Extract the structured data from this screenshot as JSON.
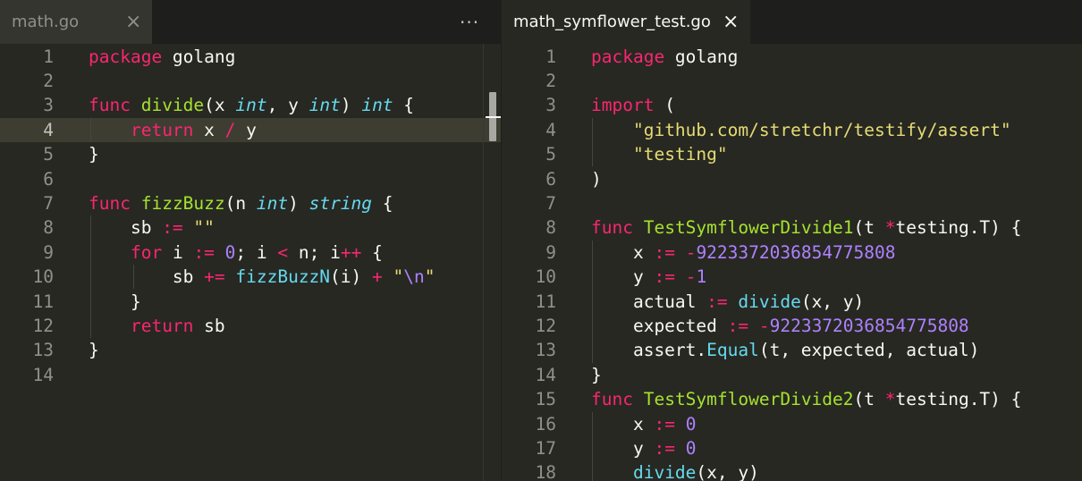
{
  "left_pane": {
    "tab": {
      "title": "math.go",
      "close_glyph": "×"
    },
    "more_glyph": "···",
    "current_line": 4,
    "lines": [
      {
        "n": "1",
        "t": [
          [
            "kw",
            "package"
          ],
          [
            "pl",
            " golang"
          ]
        ]
      },
      {
        "n": "2",
        "t": []
      },
      {
        "n": "3",
        "t": [
          [
            "kw",
            "func"
          ],
          [
            "pl",
            " "
          ],
          [
            "fn",
            "divide"
          ],
          [
            "pl",
            "(x "
          ],
          [
            "ty",
            "int"
          ],
          [
            "pl",
            ", y "
          ],
          [
            "ty",
            "int"
          ],
          [
            "pl",
            ") "
          ],
          [
            "ty",
            "int"
          ],
          [
            "pl",
            " {"
          ]
        ]
      },
      {
        "n": "4",
        "t": [
          [
            "pl",
            "    "
          ],
          [
            "kw",
            "return"
          ],
          [
            "pl",
            " x "
          ],
          [
            "op",
            "/"
          ],
          [
            "pl",
            " y"
          ]
        ]
      },
      {
        "n": "5",
        "t": [
          [
            "pl",
            "}"
          ]
        ]
      },
      {
        "n": "6",
        "t": []
      },
      {
        "n": "7",
        "t": [
          [
            "kw",
            "func"
          ],
          [
            "pl",
            " "
          ],
          [
            "fn",
            "fizzBuzz"
          ],
          [
            "pl",
            "(n "
          ],
          [
            "ty",
            "int"
          ],
          [
            "pl",
            ") "
          ],
          [
            "ty",
            "string"
          ],
          [
            "pl",
            " {"
          ]
        ]
      },
      {
        "n": "8",
        "t": [
          [
            "pl",
            "    sb "
          ],
          [
            "op",
            ":="
          ],
          [
            "pl",
            " "
          ],
          [
            "str",
            "\"\""
          ]
        ]
      },
      {
        "n": "9",
        "t": [
          [
            "pl",
            "    "
          ],
          [
            "kw",
            "for"
          ],
          [
            "pl",
            " i "
          ],
          [
            "op",
            ":="
          ],
          [
            "pl",
            " "
          ],
          [
            "num",
            "0"
          ],
          [
            "pl",
            "; i "
          ],
          [
            "op",
            "<"
          ],
          [
            "pl",
            " n; i"
          ],
          [
            "op",
            "++"
          ],
          [
            "pl",
            " {"
          ]
        ]
      },
      {
        "n": "10",
        "t": [
          [
            "pl",
            "        sb "
          ],
          [
            "op",
            "+="
          ],
          [
            "pl",
            " "
          ],
          [
            "call",
            "fizzBuzzN"
          ],
          [
            "pl",
            "(i) "
          ],
          [
            "op",
            "+"
          ],
          [
            "pl",
            " "
          ],
          [
            "str",
            "\""
          ],
          [
            "num",
            "\\n"
          ],
          [
            "str",
            "\""
          ]
        ]
      },
      {
        "n": "11",
        "t": [
          [
            "pl",
            "    }"
          ]
        ]
      },
      {
        "n": "12",
        "t": [
          [
            "pl",
            "    "
          ],
          [
            "kw",
            "return"
          ],
          [
            "pl",
            " sb"
          ]
        ]
      },
      {
        "n": "13",
        "t": [
          [
            "pl",
            "}"
          ]
        ]
      },
      {
        "n": "14",
        "t": []
      }
    ]
  },
  "right_pane": {
    "tab": {
      "title": "math_symflower_test.go",
      "close_glyph": "×"
    },
    "lines": [
      {
        "n": "1",
        "t": [
          [
            "kw",
            "package"
          ],
          [
            "pl",
            " golang"
          ]
        ]
      },
      {
        "n": "2",
        "t": []
      },
      {
        "n": "3",
        "t": [
          [
            "kw",
            "import"
          ],
          [
            "pl",
            " ("
          ]
        ]
      },
      {
        "n": "4",
        "t": [
          [
            "pl",
            "    "
          ],
          [
            "str",
            "\"github.com/stretchr/testify/assert\""
          ]
        ]
      },
      {
        "n": "5",
        "t": [
          [
            "pl",
            "    "
          ],
          [
            "str",
            "\"testing\""
          ]
        ]
      },
      {
        "n": "6",
        "t": [
          [
            "pl",
            ")"
          ]
        ]
      },
      {
        "n": "7",
        "t": []
      },
      {
        "n": "8",
        "t": [
          [
            "kw",
            "func"
          ],
          [
            "pl",
            " "
          ],
          [
            "fn",
            "TestSymflowerDivide1"
          ],
          [
            "pl",
            "(t "
          ],
          [
            "op",
            "*"
          ],
          [
            "pl",
            "testing.T) {"
          ]
        ]
      },
      {
        "n": "9",
        "t": [
          [
            "pl",
            "    x "
          ],
          [
            "op",
            ":="
          ],
          [
            "pl",
            " "
          ],
          [
            "op",
            "-"
          ],
          [
            "num",
            "9223372036854775808"
          ]
        ]
      },
      {
        "n": "10",
        "t": [
          [
            "pl",
            "    y "
          ],
          [
            "op",
            ":="
          ],
          [
            "pl",
            " "
          ],
          [
            "op",
            "-"
          ],
          [
            "num",
            "1"
          ]
        ]
      },
      {
        "n": "11",
        "t": [
          [
            "pl",
            "    actual "
          ],
          [
            "op",
            ":="
          ],
          [
            "pl",
            " "
          ],
          [
            "call",
            "divide"
          ],
          [
            "pl",
            "(x, y)"
          ]
        ]
      },
      {
        "n": "12",
        "t": [
          [
            "pl",
            "    expected "
          ],
          [
            "op",
            ":="
          ],
          [
            "pl",
            " "
          ],
          [
            "op",
            "-"
          ],
          [
            "num",
            "9223372036854775808"
          ]
        ]
      },
      {
        "n": "13",
        "t": [
          [
            "pl",
            "    assert."
          ],
          [
            "call",
            "Equal"
          ],
          [
            "pl",
            "(t, expected, actual)"
          ]
        ]
      },
      {
        "n": "14",
        "t": [
          [
            "pl",
            "}"
          ]
        ]
      },
      {
        "n": "15",
        "t": [
          [
            "kw",
            "func"
          ],
          [
            "pl",
            " "
          ],
          [
            "fn",
            "TestSymflowerDivide2"
          ],
          [
            "pl",
            "(t "
          ],
          [
            "op",
            "*"
          ],
          [
            "pl",
            "testing.T) {"
          ]
        ]
      },
      {
        "n": "16",
        "t": [
          [
            "pl",
            "    x "
          ],
          [
            "op",
            ":="
          ],
          [
            "pl",
            " "
          ],
          [
            "num",
            "0"
          ]
        ]
      },
      {
        "n": "17",
        "t": [
          [
            "pl",
            "    y "
          ],
          [
            "op",
            ":="
          ],
          [
            "pl",
            " "
          ],
          [
            "num",
            "0"
          ]
        ]
      },
      {
        "n": "18",
        "t": [
          [
            "pl",
            "    "
          ],
          [
            "call",
            "divide"
          ],
          [
            "pl",
            "(x, y)"
          ]
        ]
      }
    ]
  },
  "theme": {
    "background": "#272822",
    "keyword": "#f92672",
    "function": "#a6e22e",
    "type": "#66d9ef",
    "string": "#e6db74",
    "number": "#ae81ff",
    "text": "#f8f8f2"
  }
}
